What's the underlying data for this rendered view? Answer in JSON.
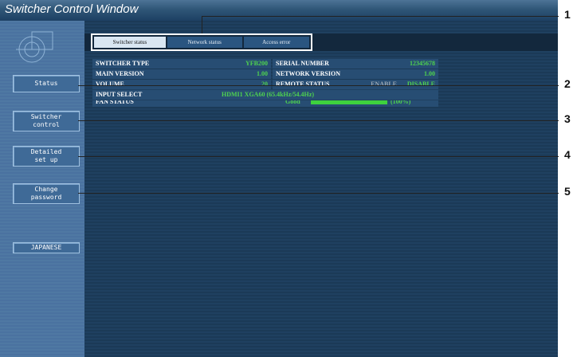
{
  "window": {
    "title": "Switcher Control Window"
  },
  "sidebar": {
    "buttons": [
      {
        "label": "Status"
      },
      {
        "label": "Switcher\ncontrol"
      },
      {
        "label": "Detailed\nset up"
      },
      {
        "label": "Change\npassword"
      },
      {
        "label": "JAPANESE"
      }
    ]
  },
  "tabs": [
    {
      "label": "Switcher status",
      "active": true
    },
    {
      "label": "Network status",
      "active": false
    },
    {
      "label": "Access error",
      "active": false
    }
  ],
  "status": {
    "switcher_type_label": "SWITCHER TYPE",
    "switcher_type_value": "YFB200",
    "serial_number_label": "SERIAL NUMBER",
    "serial_number_value": "12345678",
    "main_version_label": "MAIN VERSION",
    "main_version_value": "1.00",
    "network_version_label": "NETWORK VERSION",
    "network_version_value": "1.00",
    "volume_label": "VOLUME",
    "volume_value": "20",
    "remote_status_label": "REMOTE STATUS",
    "remote_status_enable": "ENABLE",
    "remote_status_disable": "DISABLE",
    "input_select_label": "INPUT SELECT",
    "input_select_value": "HDMI1   XGA60 (65.4kHz/54.4Hz)",
    "fan_status_label": "FAN STATUS",
    "fan_status_value": "Good",
    "fan_status_percent": "(100%)",
    "fan_level": 1.0
  },
  "callouts": [
    "1",
    "2",
    "3",
    "4",
    "5"
  ],
  "colors": {
    "value_green": "#4fd34f",
    "inactive_gray": "#9aa7b3",
    "panel_blue": "#1c3a57"
  }
}
